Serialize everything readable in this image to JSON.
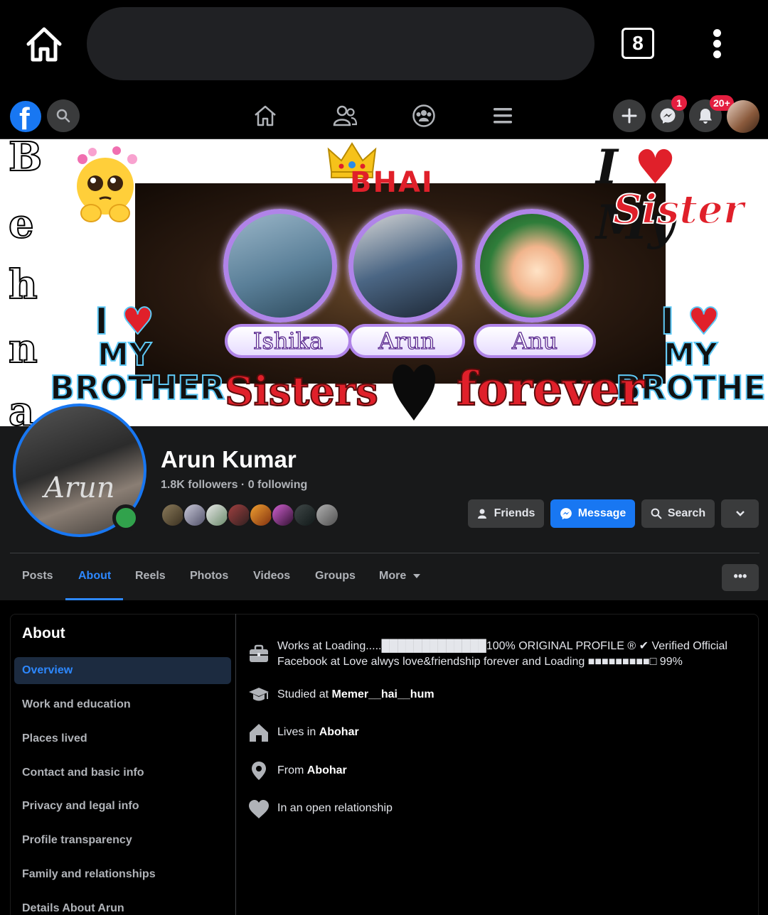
{
  "browser": {
    "tab_count": "8",
    "icons": {
      "home": "home-icon",
      "menu": "kebab-menu-icon"
    }
  },
  "nav": {
    "messenger_badge": "1",
    "notifications_badge": "20+",
    "icons": [
      "facebook-logo",
      "search-icon",
      "home-icon",
      "friends-icon",
      "groups-icon",
      "menu-icon",
      "plus-icon",
      "messenger-icon",
      "bell-icon",
      "avatar"
    ]
  },
  "cover": {
    "side_letters": [
      "B",
      "e",
      "h",
      "n",
      "a"
    ],
    "bhai_text": "BHAI",
    "names": [
      "Ishika",
      "Arun",
      "Anu"
    ],
    "i_love_text": "I",
    "my_text": "My",
    "sister_text": "Sister",
    "brother_left": {
      "i": "I",
      "my": "MY",
      "brother": "BROTHER"
    },
    "brother_right": {
      "i": "I",
      "my": "MY",
      "brother": "BROTHER"
    },
    "sisters_text": "Sisters",
    "forever_text": "forever",
    "pfp_name": "Arun",
    "accent_colors": {
      "red": "#e0202a",
      "purple": "#b084e8",
      "blue_outline": "#5ec8f5"
    }
  },
  "profile": {
    "name": "Arun Kumar",
    "counts": "1.8K followers · 0 following",
    "buttons": {
      "friends": "Friends",
      "message": "Message",
      "search": "Search"
    },
    "online_color": "#31a24c"
  },
  "tabs": [
    "Posts",
    "About",
    "Reels",
    "Photos",
    "Videos",
    "Groups",
    "More"
  ],
  "active_tab": "About",
  "about": {
    "title": "About",
    "sidebar": [
      "Overview",
      "Work and education",
      "Places lived",
      "Contact and basic info",
      "Privacy and legal info",
      "Profile transparency",
      "Family and relationships",
      "Details About Arun"
    ],
    "work": {
      "prefix": "Works at",
      "line1": "Loading.....█████████████100% ORIGINAL PROFILE ® ✔ Verified Official",
      "line2": "Facebook at Love alwys love&friendship forever and Loading ■■■■■■■■■□ 99%"
    },
    "study": {
      "prefix": "Studied at ",
      "value": "Memer__hai__hum"
    },
    "lives": {
      "prefix": "Lives in ",
      "value": "Abohar"
    },
    "from": {
      "prefix": "From ",
      "value": "Abohar"
    },
    "relationship": "In an open relationship"
  }
}
